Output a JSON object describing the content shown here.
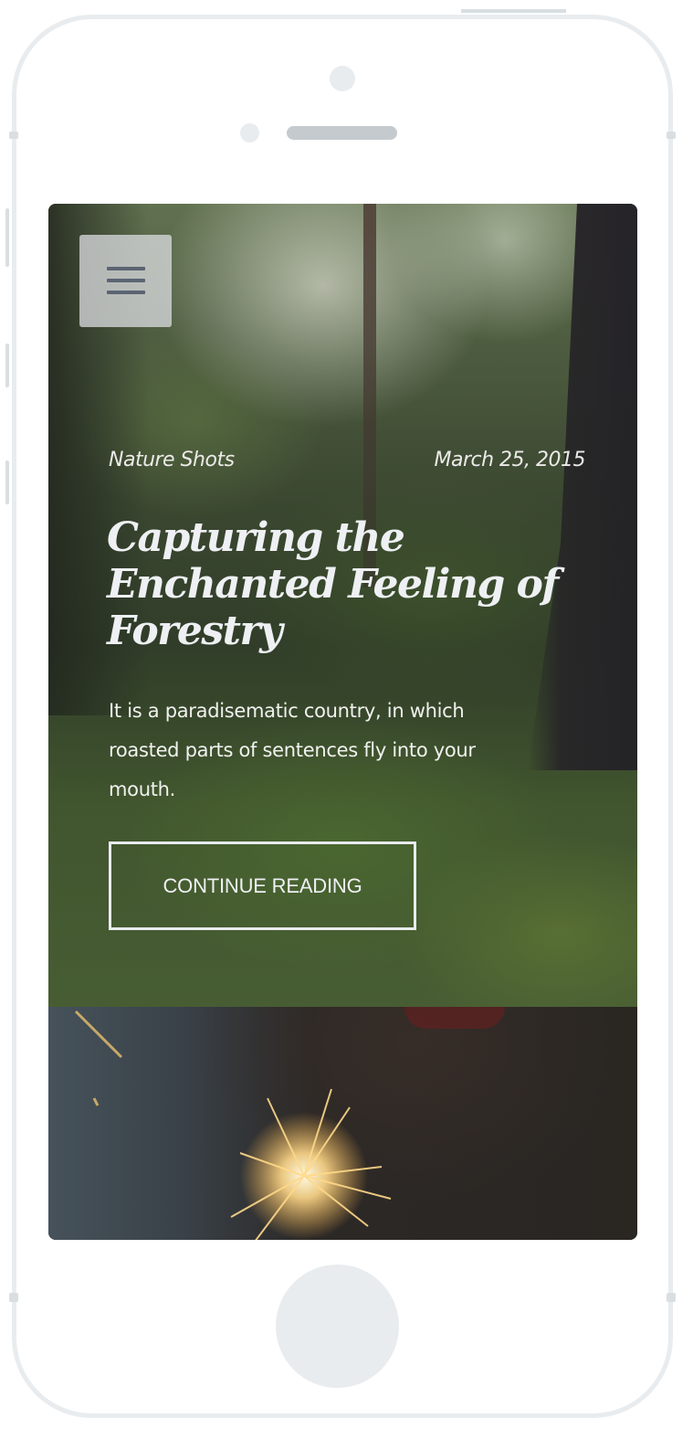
{
  "post": {
    "category": "Nature Shots",
    "date": "March 25, 2015",
    "title": "Capturing the Enchanted Feeling of Forestry",
    "excerpt": "It is a paradisematic country, in which roasted parts of sentences fly into your mouth.",
    "cta_label": "CONTINUE READING"
  },
  "header": {
    "menu_icon": "hamburger-menu-icon"
  },
  "colors": {
    "text": "#eef0f3",
    "menu_bg": "#dcdee2",
    "menu_icon": "#5b6472",
    "frame": "#e8ecee"
  }
}
